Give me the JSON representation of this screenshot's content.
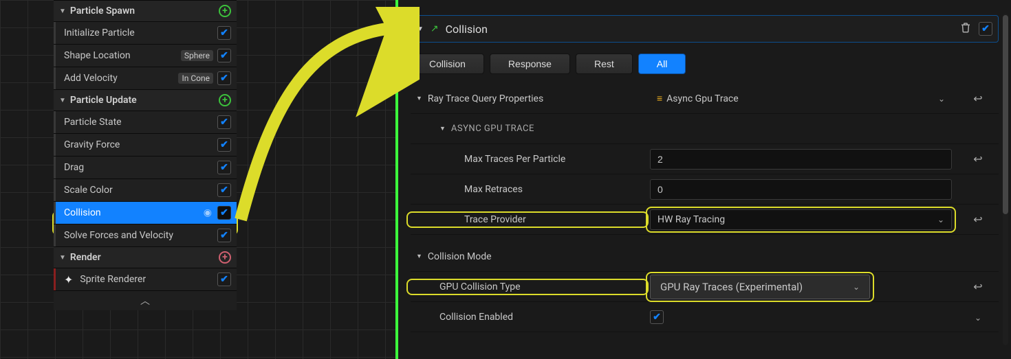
{
  "left": {
    "sections": [
      {
        "title": "Particle Spawn",
        "tint": "green",
        "modules": [
          {
            "label": "Initialize Particle",
            "checked": true
          },
          {
            "label": "Shape Location",
            "badge": "Sphere",
            "checked": true
          },
          {
            "label": "Add Velocity",
            "badge": "In Cone",
            "checked": true
          }
        ]
      },
      {
        "title": "Particle Update",
        "tint": "green",
        "modules": [
          {
            "label": "Particle State",
            "checked": true
          },
          {
            "label": "Gravity Force",
            "checked": true
          },
          {
            "label": "Drag",
            "checked": true
          },
          {
            "label": "Scale Color",
            "checked": true
          },
          {
            "label": "Collision",
            "checked": true,
            "selected": true,
            "eye": true
          },
          {
            "label": "Solve Forces and Velocity",
            "checked": true
          }
        ]
      },
      {
        "title": "Render",
        "tint": "pink",
        "modules": [
          {
            "label": "Sprite Renderer",
            "checked": true,
            "renderIcon": true
          }
        ]
      }
    ],
    "collapse": "^"
  },
  "right": {
    "headerTitle": "Collision",
    "filters": [
      {
        "label": "Collision",
        "active": false
      },
      {
        "label": "Response",
        "active": false
      },
      {
        "label": "Rest",
        "active": false
      },
      {
        "label": "All",
        "active": true
      }
    ],
    "rayTraceQuery": {
      "label": "Ray Trace Query Properties",
      "value": "Async Gpu Trace"
    },
    "asyncSection": "ASYNC GPU TRACE",
    "maxTraces": {
      "label": "Max Traces Per Particle",
      "value": "2"
    },
    "maxRetraces": {
      "label": "Max Retraces",
      "value": "0"
    },
    "traceProvider": {
      "label": "Trace Provider",
      "value": "HW Ray Tracing"
    },
    "collisionModeLabel": "Collision Mode",
    "gpuCollisionType": {
      "label": "GPU Collision Type",
      "value": "GPU Ray Traces (Experimental)"
    },
    "collisionEnabled": {
      "label": "Collision Enabled",
      "checked": true
    }
  }
}
